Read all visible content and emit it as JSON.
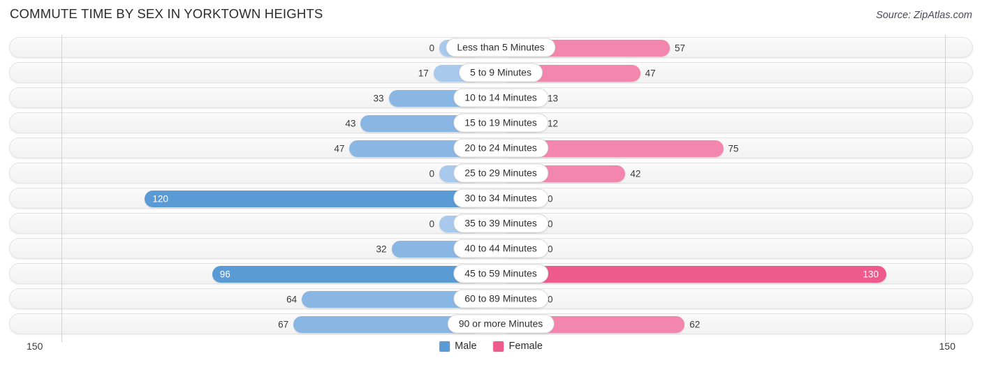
{
  "header": {
    "title": "COMMUTE TIME BY SEX IN YORKTOWN HEIGHTS",
    "source": "Source: ZipAtlas.com"
  },
  "axis": {
    "left_tick": "150",
    "right_tick": "150",
    "max": 150
  },
  "legend": {
    "items": [
      {
        "label": "Male",
        "color": "#5a9bd5"
      },
      {
        "label": "Female",
        "color": "#ef5a8c"
      }
    ]
  },
  "colors": {
    "male_light": "#a8c9ec",
    "male_mid": "#8ab6e3",
    "male_dark": "#5a9bd5",
    "female_light": "#f9a9c6",
    "female_mid": "#f386ad",
    "female_dark": "#ef5a8c",
    "track": "#f6f6f6",
    "axis": "#d2d2d2"
  },
  "chart_data": {
    "type": "bar",
    "orientation": "horizontal-diverging",
    "title": "COMMUTE TIME BY SEX IN YORKTOWN HEIGHTS",
    "xlabel": "",
    "ylabel": "",
    "xlim": [
      -150,
      150
    ],
    "grid": false,
    "legend_position": "bottom-center",
    "categories": [
      "Less than 5 Minutes",
      "5 to 9 Minutes",
      "10 to 14 Minutes",
      "15 to 19 Minutes",
      "20 to 24 Minutes",
      "25 to 29 Minutes",
      "30 to 34 Minutes",
      "35 to 39 Minutes",
      "40 to 44 Minutes",
      "45 to 59 Minutes",
      "60 to 89 Minutes",
      "90 or more Minutes"
    ],
    "series": [
      {
        "name": "Male",
        "values": [
          0,
          17,
          33,
          43,
          47,
          0,
          120,
          0,
          32,
          96,
          64,
          67
        ]
      },
      {
        "name": "Female",
        "values": [
          57,
          47,
          13,
          12,
          75,
          42,
          0,
          0,
          0,
          130,
          0,
          62
        ]
      }
    ]
  },
  "rows": [
    {
      "label": "Less than 5 Minutes",
      "male": "0",
      "female": "57"
    },
    {
      "label": "5 to 9 Minutes",
      "male": "17",
      "female": "47"
    },
    {
      "label": "10 to 14 Minutes",
      "male": "33",
      "female": "13"
    },
    {
      "label": "15 to 19 Minutes",
      "male": "43",
      "female": "12"
    },
    {
      "label": "20 to 24 Minutes",
      "male": "47",
      "female": "75"
    },
    {
      "label": "25 to 29 Minutes",
      "male": "0",
      "female": "42"
    },
    {
      "label": "30 to 34 Minutes",
      "male": "120",
      "female": "0"
    },
    {
      "label": "35 to 39 Minutes",
      "male": "0",
      "female": "0"
    },
    {
      "label": "40 to 44 Minutes",
      "male": "32",
      "female": "0"
    },
    {
      "label": "45 to 59 Minutes",
      "male": "96",
      "female": "130"
    },
    {
      "label": "60 to 89 Minutes",
      "male": "64",
      "female": "0"
    },
    {
      "label": "90 or more Minutes",
      "male": "67",
      "female": "62"
    }
  ]
}
